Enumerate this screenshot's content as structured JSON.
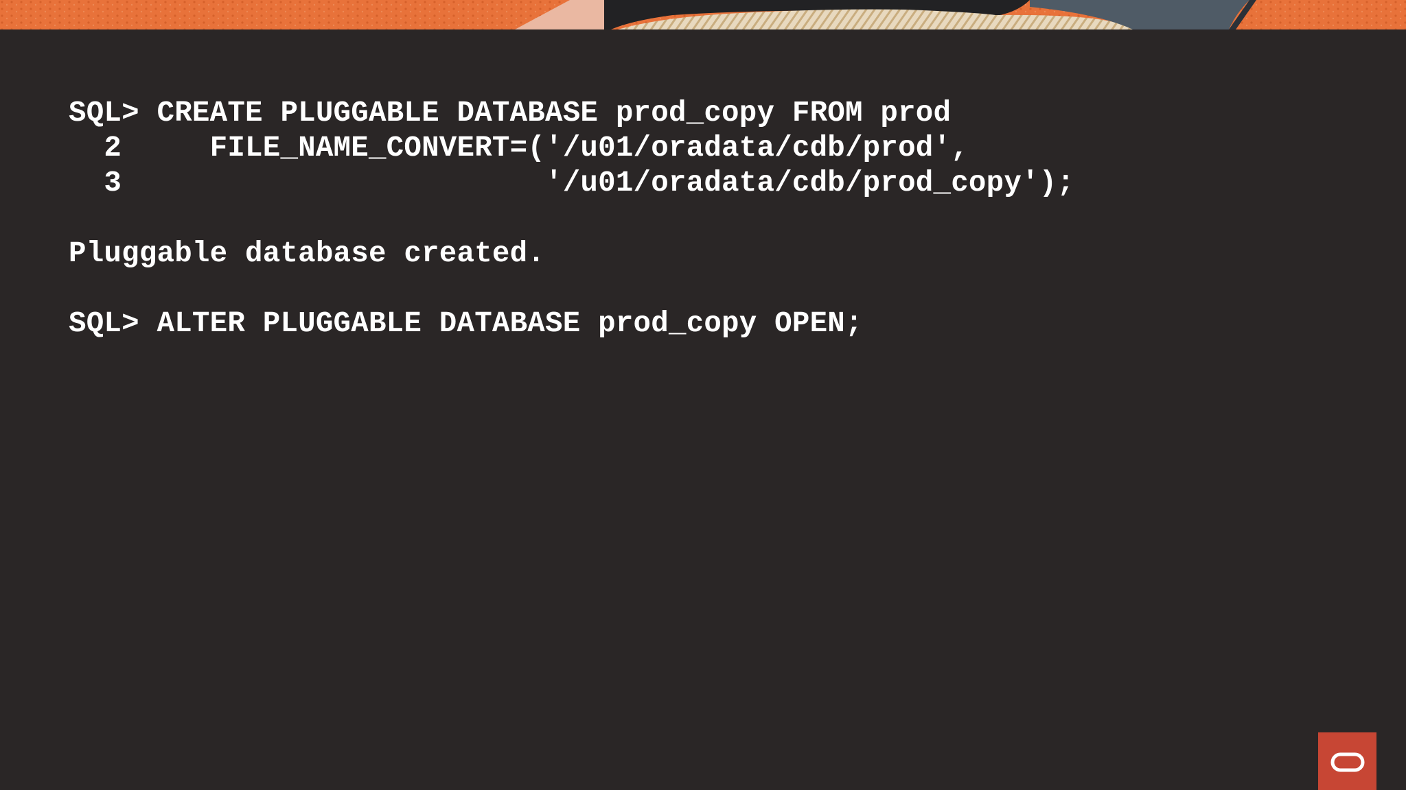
{
  "terminal": {
    "lines": [
      "SQL> CREATE PLUGGABLE DATABASE prod_copy FROM prod",
      "  2     FILE_NAME_CONVERT=('/u01/oradata/cdb/prod',",
      "  3                        '/u01/oradata/cdb/prod_copy');",
      "",
      "Pluggable database created.",
      "",
      "SQL> ALTER PLUGGABLE DATABASE prod_copy OPEN;"
    ]
  },
  "colors": {
    "background": "#2a2626",
    "text": "#ffffff",
    "banner_orange": "#e8723a",
    "logo_red": "#c74634"
  },
  "icons": {
    "logo": "oracle-logo-icon"
  }
}
